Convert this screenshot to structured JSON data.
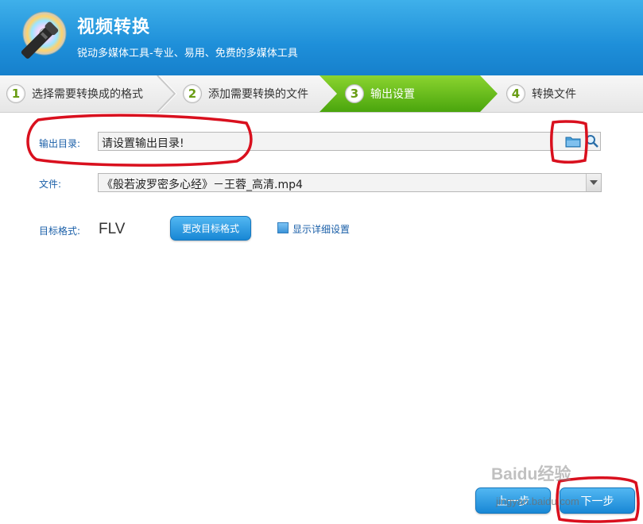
{
  "header": {
    "title": "视频转换",
    "subtitle": "锐动多媒体工具-专业、易用、免费的多媒体工具"
  },
  "steps": [
    {
      "num": "1",
      "label": "选择需要转换成的格式",
      "active": false
    },
    {
      "num": "2",
      "label": "添加需要转换的文件",
      "active": false
    },
    {
      "num": "3",
      "label": "输出设置",
      "active": true
    },
    {
      "num": "4",
      "label": "转换文件",
      "active": false
    }
  ],
  "form": {
    "outdir_label": "输出目录:",
    "outdir_value": "请设置输出目录!",
    "file_label": "文件:",
    "file_value": "《般若波罗密多心经》－王蓉_高清.mp4",
    "format_label": "目标格式:",
    "format_value": "FLV",
    "change_format_label": "更改目标格式",
    "detail_label": "显示详细设置"
  },
  "nav": {
    "prev_label": "上一步",
    "next_label": "下一步"
  },
  "watermark": {
    "text": "Baidu经验",
    "url": "jingyan.baidu.com"
  },
  "colors": {
    "header_blue": "#1e8fd9",
    "active_step_green": "#5cb615",
    "annotation_red": "#d9101e",
    "label_blue": "#1a5fa8"
  },
  "icons": [
    "disc-logo-icon",
    "folder-icon",
    "search-icon",
    "chevron-down-icon",
    "paw-icon"
  ]
}
